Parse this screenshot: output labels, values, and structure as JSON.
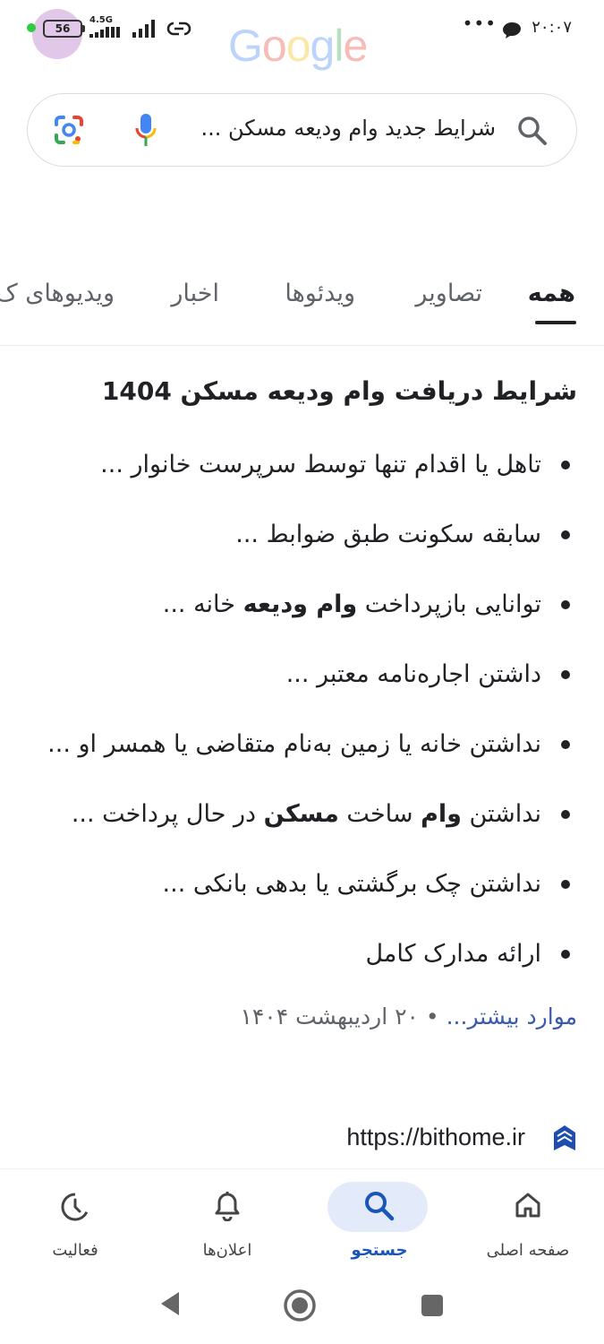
{
  "status_bar": {
    "battery": "56",
    "network": "4.5G",
    "time": "۲۰:۰۷",
    "overflow": "•••"
  },
  "logo": {
    "letters": [
      "G",
      "o",
      "o",
      "g",
      "l",
      "e"
    ]
  },
  "search": {
    "query": "شرایط جدید وام ودیعه مسکن ..."
  },
  "tabs": [
    {
      "label": "همه",
      "active": true
    },
    {
      "label": "تصاویر",
      "active": false
    },
    {
      "label": "ویدئوها",
      "active": false
    },
    {
      "label": "اخبار",
      "active": false
    },
    {
      "label": "ویدیوهای ک",
      "active": false
    }
  ],
  "result": {
    "heading": "شرایط دریافت وام ودیعه مسکن 1404",
    "bullets": [
      {
        "parts": [
          {
            "text": "تاهل یا اقدام تنها توسط سرپرست خانوار ...",
            "bold": false
          }
        ]
      },
      {
        "parts": [
          {
            "text": "سابقه سکونت طبق ضوابط ...",
            "bold": false
          }
        ]
      },
      {
        "parts": [
          {
            "text": "توانایی بازپرداخت ",
            "bold": false
          },
          {
            "text": "وام ودیعه",
            "bold": true
          },
          {
            "text": " خانه ...",
            "bold": false
          }
        ]
      },
      {
        "parts": [
          {
            "text": "داشتن اجاره‌نامه معتبر ...",
            "bold": false
          }
        ]
      },
      {
        "parts": [
          {
            "text": "نداشتن خانه یا زمین به‌نام متقاضی یا همسر او ...",
            "bold": false
          }
        ]
      },
      {
        "parts": [
          {
            "text": "نداشتن ",
            "bold": false
          },
          {
            "text": "وام",
            "bold": true
          },
          {
            "text": " ساخت ",
            "bold": false
          },
          {
            "text": "مسکن",
            "bold": true
          },
          {
            "text": " در حال پرداخت ...",
            "bold": false
          }
        ]
      },
      {
        "parts": [
          {
            "text": "نداشتن چک برگشتی یا بدهی بانکی ...",
            "bold": false
          }
        ]
      },
      {
        "parts": [
          {
            "text": "ارائه مدارک کامل",
            "bold": false
          }
        ]
      }
    ],
    "more_link": "موارد بیشتر...",
    "separator": "•",
    "date": "۲۰ اردیبهشت ۱۴۰۴",
    "source_url": "https://bithome.ir"
  },
  "bottom_nav": [
    {
      "label": "صفحه اصلی",
      "icon": "home-icon",
      "active": false
    },
    {
      "label": "جستجو",
      "icon": "search-icon",
      "active": true
    },
    {
      "label": "اعلان‌ها",
      "icon": "bell-icon",
      "active": false
    },
    {
      "label": "فعالیت",
      "icon": "activity-icon",
      "active": false
    }
  ],
  "colors": {
    "accent": "#1a56b8",
    "active_pill": "#e3ebfb",
    "link": "#3b5aa8"
  }
}
